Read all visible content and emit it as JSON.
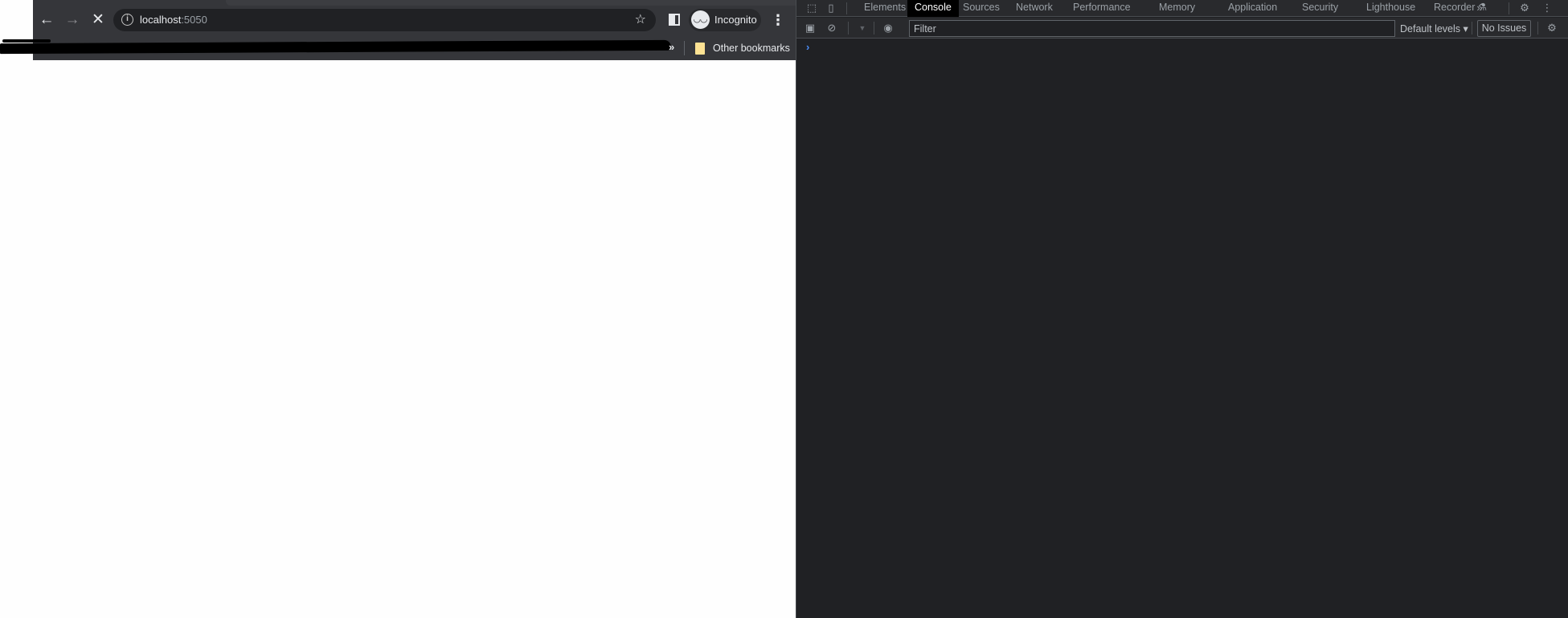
{
  "browser": {
    "url_host": "localhost",
    "url_port": ":5050",
    "profile_label": "Incognito",
    "bookmarks": {
      "overflow_label": "»",
      "other_bookmarks_label": "Other bookmarks"
    },
    "icons": {
      "back": "←",
      "forward": "→",
      "stop": "✕",
      "info": "i",
      "star": "☆",
      "menu": "⋮",
      "incognito": "👓"
    }
  },
  "devtools": {
    "tabs": [
      {
        "label": "Elements",
        "active": false
      },
      {
        "label": "Console",
        "active": true
      },
      {
        "label": "Sources",
        "active": false
      },
      {
        "label": "Network",
        "active": false
      },
      {
        "label": "Performance",
        "active": false
      },
      {
        "label": "Memory",
        "active": false
      },
      {
        "label": "Application",
        "active": false
      },
      {
        "label": "Security",
        "active": false
      },
      {
        "label": "Lighthouse",
        "active": false
      },
      {
        "label": "Recorder ⚗",
        "active": false
      }
    ],
    "more_tabs_label": "»",
    "filter_placeholder": "Filter",
    "levels_label": "Default levels ▾",
    "issues_label": "No Issues",
    "prompt_glyph": "›",
    "colors": {
      "background": "#202124",
      "toolbar": "#292a2d",
      "prompt": "#4b8cf5",
      "active_tab": "#000000"
    }
  }
}
